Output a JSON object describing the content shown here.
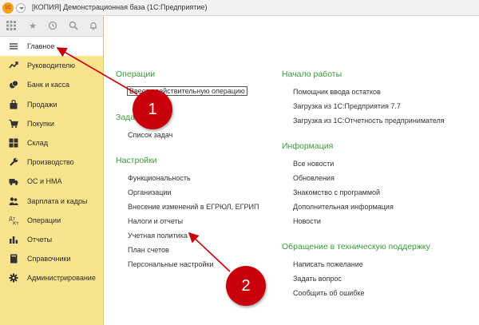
{
  "window": {
    "title": "[КОПИЯ] Демонстрационная база  (1С:Предприятие)",
    "logo_text": "1С"
  },
  "toolbar": {
    "icons": [
      "apps-grid-icon",
      "favorites-star-icon",
      "history-icon",
      "search-icon",
      "notifications-bell-icon"
    ]
  },
  "sidebar": {
    "items": [
      {
        "label": "Главное",
        "icon": "menu-lines-icon",
        "active": true
      },
      {
        "label": "Руководителю",
        "icon": "trend-icon"
      },
      {
        "label": "Банк и касса",
        "icon": "coins-icon"
      },
      {
        "label": "Продажи",
        "icon": "shopping-bag-icon"
      },
      {
        "label": "Покупки",
        "icon": "cart-icon"
      },
      {
        "label": "Склад",
        "icon": "warehouse-grid-icon"
      },
      {
        "label": "Производство",
        "icon": "wrench-icon"
      },
      {
        "label": "ОС и НМА",
        "icon": "truck-icon"
      },
      {
        "label": "Зарплата и кадры",
        "icon": "people-icon"
      },
      {
        "label": "Операции",
        "icon": "dt-kt-icon"
      },
      {
        "label": "Отчеты",
        "icon": "bar-chart-icon"
      },
      {
        "label": "Справочники",
        "icon": "book-icon"
      },
      {
        "label": "Администрирование",
        "icon": "gear-icon"
      }
    ]
  },
  "main": {
    "left": {
      "operations": {
        "title": "Операции",
        "links": [
          "Ввести действительную операцию"
        ]
      },
      "tasks": {
        "title": "Задачи",
        "links": [
          "Список задач"
        ]
      },
      "settings": {
        "title": "Настройки",
        "links": [
          "Функциональность",
          "Организации",
          "Внесение изменений в ЕГРЮЛ, ЕГРИП",
          "Налоги и отчеты",
          "Учетная политика",
          "План счетов",
          "Персональные настройки"
        ]
      }
    },
    "right": {
      "start": {
        "title": "Начало работы",
        "links": [
          "Помощник ввода остатков",
          "Загрузка из 1С:Предприятия 7.7",
          "Загрузка из 1С:Отчетность предпринимателя"
        ]
      },
      "info": {
        "title": "Информация",
        "links": [
          "Все новости",
          "Обновления",
          "Знакомство с программой",
          "Дополнительная информация",
          "Новости"
        ]
      },
      "support": {
        "title": "Обращение в техническую поддержку",
        "links": [
          "Написать пожелание",
          "Задать вопрос",
          "Сообщить об ошибке"
        ]
      }
    }
  },
  "annotations": {
    "badge1": "1",
    "badge2": "2",
    "color": "#c8000b"
  }
}
